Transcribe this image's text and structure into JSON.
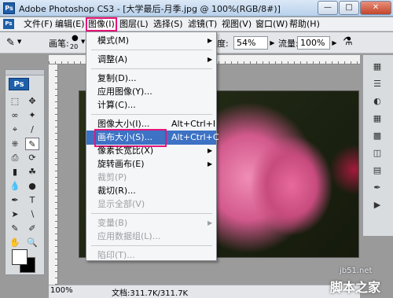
{
  "window": {
    "title": "Adobe Photoshop CS3 - [大学最后-月季.jpg @ 100%(RGB/8#)]",
    "app_badge": "Ps"
  },
  "menubar": [
    "文件(F)",
    "编辑(E)",
    "图像(I)",
    "图层(L)",
    "选择(S)",
    "滤镜(T)",
    "视图(V)",
    "窗口(W)",
    "帮助(H)"
  ],
  "options": {
    "brush_label": "画笔:",
    "brush_size": "20",
    "opacity_label": "度:",
    "opacity_value": "54%",
    "flow_label": "流量:",
    "flow_value": "100%"
  },
  "toolbox": {
    "logo": "Ps"
  },
  "image_menu": [
    {
      "label": "模式(M)",
      "shortcut": "",
      "submenu": true,
      "disabled": false
    },
    {
      "sep": true
    },
    {
      "label": "调整(A)",
      "shortcut": "",
      "submenu": true,
      "disabled": false
    },
    {
      "sep": true
    },
    {
      "label": "复制(D)...",
      "shortcut": "",
      "submenu": false,
      "disabled": false
    },
    {
      "label": "应用图像(Y)...",
      "shortcut": "",
      "submenu": false,
      "disabled": false
    },
    {
      "label": "计算(C)...",
      "shortcut": "",
      "submenu": false,
      "disabled": false
    },
    {
      "sep": true
    },
    {
      "label": "图像大小(I)...",
      "shortcut": "Alt+Ctrl+I",
      "submenu": false,
      "disabled": false
    },
    {
      "label": "画布大小(S)...",
      "shortcut": "Alt+Ctrl+C",
      "submenu": false,
      "disabled": false,
      "highlight": true
    },
    {
      "label": "像素长宽比(X)",
      "shortcut": "",
      "submenu": true,
      "disabled": false
    },
    {
      "label": "旋转画布(E)",
      "shortcut": "",
      "submenu": true,
      "disabled": false
    },
    {
      "label": "裁剪(P)",
      "shortcut": "",
      "submenu": false,
      "disabled": true
    },
    {
      "label": "裁切(R)...",
      "shortcut": "",
      "submenu": false,
      "disabled": false
    },
    {
      "label": "显示全部(V)",
      "shortcut": "",
      "submenu": false,
      "disabled": true
    },
    {
      "sep": true
    },
    {
      "label": "变量(B)",
      "shortcut": "",
      "submenu": true,
      "disabled": true
    },
    {
      "label": "应用数据组(L)...",
      "shortcut": "",
      "submenu": false,
      "disabled": true
    },
    {
      "sep": true
    },
    {
      "label": "陷印(T)...",
      "shortcut": "",
      "submenu": false,
      "disabled": true
    }
  ],
  "statusbar": {
    "zoom": "100%",
    "doc_info": "文档:311.7K/311.7K"
  },
  "watermark": {
    "site": "jb51.net",
    "name": "脚本之家"
  }
}
